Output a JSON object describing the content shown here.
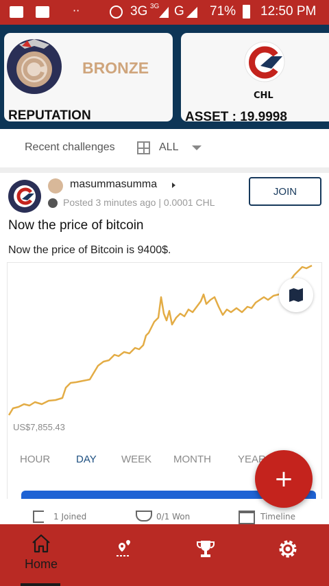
{
  "status_bar": {
    "network": "3G",
    "network_small": "3G",
    "network2": "G",
    "battery": "71%",
    "time": "12:50 PM"
  },
  "header": {
    "rank": "BRONZE",
    "reputation_label": "REPUTATION",
    "token": "CHL",
    "asset_label": "ASSET : 19.9998"
  },
  "filter": {
    "label": "Recent challenges",
    "value": "ALL"
  },
  "post": {
    "author": "masummasumma",
    "posted": "Posted 3 minutes ago",
    "separator": "|",
    "stake": "0.0001 CHL",
    "join_label": "JOIN",
    "title": "Now the price of bitcoin",
    "body": "Now the price of Bitcoin is 9400$.",
    "chart": {
      "min_label": "US$7,855.43",
      "ranges": [
        "HOUR",
        "DAY",
        "WEEK",
        "MONTH",
        "YEAR"
      ],
      "active_range": "DAY"
    },
    "stats": [
      "1 Joined",
      "0/1 Won",
      "Timeline"
    ]
  },
  "colors": {
    "accent_red": "#b92a24",
    "header_navy": "#0d3556",
    "rank_bronze": "#cfa57c",
    "line_gold": "#e3ac45"
  },
  "bottom_nav": {
    "items": [
      {
        "icon": "home-icon",
        "label": "Home"
      },
      {
        "icon": "route-icon",
        "label": ""
      },
      {
        "icon": "trophy-icon",
        "label": ""
      },
      {
        "icon": "gear-icon",
        "label": ""
      }
    ]
  }
}
